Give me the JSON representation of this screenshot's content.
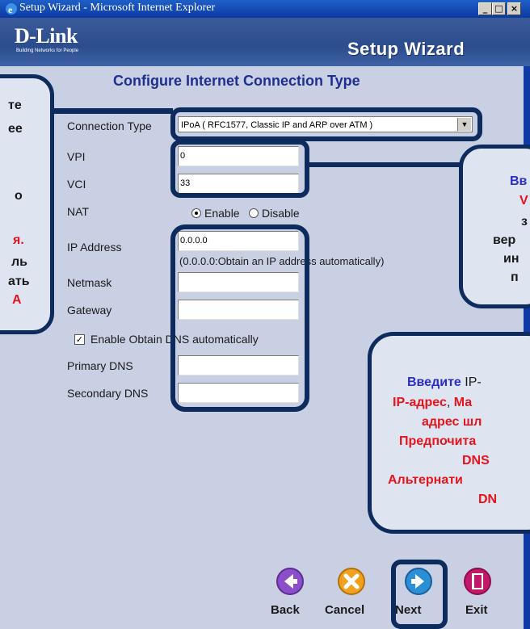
{
  "window": {
    "title": "Setup Wizard - Microsoft Internet Explorer",
    "minimize": "_",
    "maximize": "□",
    "close": "×"
  },
  "header": {
    "brand": "D-Link",
    "tagline": "Building Networks for People",
    "wizard_title": "Setup Wizard"
  },
  "form": {
    "title": "Configure Internet Connection Type",
    "connection_type": {
      "label": "Connection Type",
      "value": "IPoA ( RFC1577, Classic IP and ARP over ATM )"
    },
    "vpi": {
      "label": "VPI",
      "value": "0"
    },
    "vci": {
      "label": "VCI",
      "value": "33"
    },
    "nat": {
      "label": "NAT",
      "enable": "Enable",
      "disable": "Disable",
      "selected": "Enable"
    },
    "ip_address": {
      "label": "IP Address",
      "value": "0.0.0.0",
      "hint": "(0.0.0.0:Obtain an IP address automatically)"
    },
    "netmask": {
      "label": "Netmask",
      "value": ""
    },
    "gateway": {
      "label": "Gateway",
      "value": ""
    },
    "dns_auto": {
      "label": "Enable Obtain DNS automatically",
      "checked": true
    },
    "primary_dns": {
      "label": "Primary DNS",
      "value": ""
    },
    "secondary_dns": {
      "label": "Secondary DNS",
      "value": ""
    }
  },
  "callouts": {
    "left": {
      "l1": "те",
      "l2": "ее",
      "l3": "о",
      "l4": "я.",
      "l5": "ль",
      "l6": "ать",
      "l7": "A"
    },
    "right_top": {
      "l1": "Вв",
      "l2": "V",
      "l3": "з",
      "l4": "вер",
      "l5": "ин",
      "l6": "п"
    },
    "right_bottom": {
      "l1a": "Введите",
      "l1b": "IP-",
      "l2a": "IP-адрес",
      "l2b": ", ",
      "l2c": "Ма",
      "l3": "адрес шл",
      "l4": "Предпочита",
      "l5": "DNS",
      "l6": "Альтернати",
      "l7": "DN"
    }
  },
  "nav": {
    "back": "Back",
    "cancel": "Cancel",
    "next": "Next",
    "exit": "Exit"
  },
  "colors": {
    "accent_blue": "#2a2ec7",
    "accent_red": "#e8141b",
    "outline": "#0d2b5c"
  }
}
